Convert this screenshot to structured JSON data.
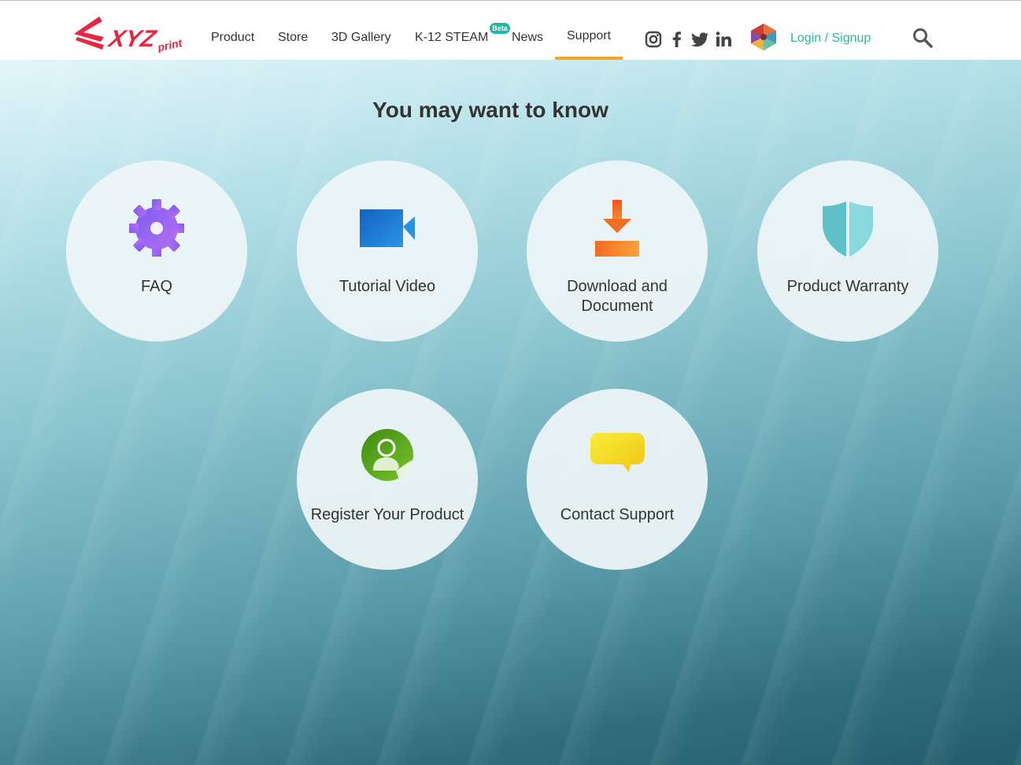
{
  "header": {
    "logo_alt": "XYZprinting",
    "nav": {
      "product": "Product",
      "store": "Store",
      "gallery": "3D Gallery",
      "steam": "K-12 STEAM",
      "steam_badge": "Beta",
      "news": "News",
      "support": "Support"
    },
    "active_nav": "Support",
    "social_icons": [
      "instagram-icon",
      "facebook-icon",
      "twitter-icon",
      "linkedin-icon"
    ],
    "login_label": "Login / Signup",
    "accent_color": "#f5a623",
    "link_color": "#2bb39b"
  },
  "main": {
    "title": "You may want to know",
    "cards": [
      {
        "label": "FAQ",
        "icon": "gear-icon",
        "color": "#9b6cf5"
      },
      {
        "label": "Tutorial Video",
        "icon": "video-camera-icon",
        "color": "#1a7fd8"
      },
      {
        "label": "Download and Document",
        "icon": "download-icon",
        "color": "#f57c28"
      },
      {
        "label": "Product Warranty",
        "icon": "shield-icon",
        "color": "#6dcbd0"
      },
      {
        "label": "Register Your Product",
        "icon": "user-register-icon",
        "color": "#5aa61a"
      },
      {
        "label": "Contact Support",
        "icon": "speech-bubble-icon",
        "color": "#f5d21c"
      }
    ]
  }
}
